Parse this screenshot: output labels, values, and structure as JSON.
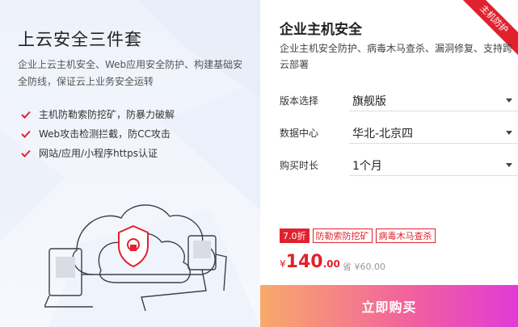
{
  "left": {
    "title": "上云安全三件套",
    "description": "企业上云主机安全、Web应用安全防护、构建基础安全防线，保证云上业务安全运转",
    "features": [
      "主机防勒索防挖矿，防暴力破解",
      "Web攻击检测拦截，防CC攻击",
      "网站/应用/小程序https认证"
    ]
  },
  "right": {
    "ribbon": "主机防护",
    "title": "企业主机安全",
    "subtitle": "企业主机安全防护、病毒木马查杀、漏洞修复、支持跨云部署",
    "options": [
      {
        "label": "版本选择",
        "value": "旗舰版"
      },
      {
        "label": "数据中心",
        "value": "华北-北京四"
      },
      {
        "label": "购买时长",
        "value": "1个月"
      }
    ],
    "tags": {
      "discount": "7.0折",
      "t1": "防勒索防挖矿",
      "t2": "病毒木马查杀"
    },
    "price": {
      "currency": "¥",
      "integer": "140",
      "decimal": ".00",
      "saved": "省 ¥60.00"
    },
    "buy_label": "立即购买"
  },
  "colors": {
    "accent": "#e0222e",
    "buy_gradient_start": "#f9a96b",
    "buy_gradient_end": "#e23ad8"
  }
}
